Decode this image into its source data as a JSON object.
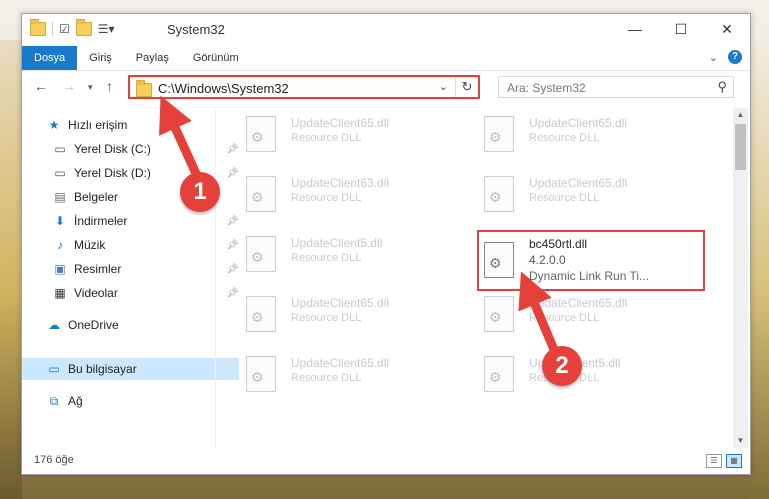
{
  "window": {
    "title": "System32"
  },
  "ribbon": {
    "tabs": [
      "Dosya",
      "Giriş",
      "Paylaş",
      "Görünüm"
    ],
    "help": "?"
  },
  "address": {
    "path": "C:\\Windows\\System32"
  },
  "search": {
    "placeholder": "Ara: System32"
  },
  "sidebar": {
    "items": [
      {
        "label": "Hızlı erişim",
        "icon": "star-icon"
      },
      {
        "label": "Yerel Disk (C:)",
        "icon": "drive-icon"
      },
      {
        "label": "Yerel Disk (D:)",
        "icon": "drive-icon"
      },
      {
        "label": "Belgeler",
        "icon": "document-icon"
      },
      {
        "label": "İndirmeler",
        "icon": "download-icon"
      },
      {
        "label": "Müzik",
        "icon": "music-icon"
      },
      {
        "label": "Resimler",
        "icon": "pictures-icon"
      },
      {
        "label": "Videolar",
        "icon": "video-icon"
      },
      {
        "label": "OneDrive",
        "icon": "cloud-icon"
      },
      {
        "label": "Bu bilgisayar",
        "icon": "computer-icon"
      },
      {
        "label": "Ağ",
        "icon": "network-icon"
      }
    ]
  },
  "files": [
    {
      "name": "UpdateClient65.dll",
      "desc": "Resource DLL"
    },
    {
      "name": "UpdateClient65.dll",
      "desc": "Resource DLL"
    },
    {
      "name": "UpdateClient63.dll",
      "desc": "Resource DLL"
    },
    {
      "name": "UpdateClient65.dll",
      "desc": "Resource DLL"
    },
    {
      "name": "UpdateClient5.dll",
      "desc": "Resource DLL"
    },
    {
      "name": "bc450rtl.dll",
      "version": "4.2.0.0",
      "desc": "Dynamic Link Run Ti..."
    },
    {
      "name": "UpdateClient65.dll",
      "desc": "Resource DLL"
    },
    {
      "name": "UpdateClient65.dll",
      "desc": "Resource DLL"
    },
    {
      "name": "UpdateClient65.dll",
      "desc": "Resource DLL"
    },
    {
      "name": "UpdateClient5.dll",
      "desc": "Resource DLL"
    }
  ],
  "status": {
    "count": "176 öğe"
  },
  "annotations": {
    "step1": "1",
    "step2": "2"
  },
  "colors": {
    "accent": "#1979ca",
    "annotation": "#e5413a"
  }
}
